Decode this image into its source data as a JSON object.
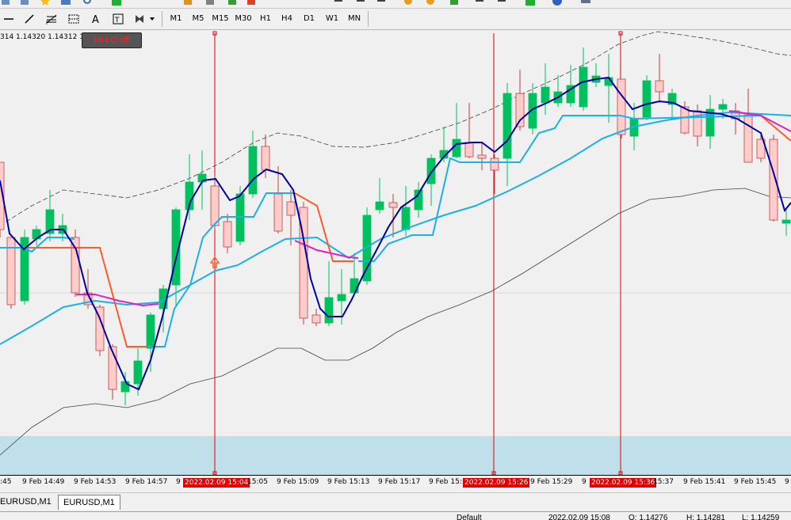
{
  "toolbar": {
    "timeframes": [
      "M1",
      "M5",
      "M15",
      "M30",
      "H1",
      "H4",
      "D1",
      "W1",
      "MN"
    ]
  },
  "chart": {
    "price_strip": "314 1.14320 1.14312 1.14",
    "hilo_button": "Hi-LO off"
  },
  "xaxis": {
    "labels": [
      ":45",
      "9 Feb 14:49",
      "9 Feb 14:53",
      "9 Feb 14:57",
      "9",
      "15:05",
      "9 Feb 15:09",
      "9 Feb 15:13",
      "9 Feb 15:17",
      "9 Feb 15:",
      "9 Feb 15:29",
      "9",
      "15:37",
      "9 Feb 15:41",
      "9 Feb 15:45",
      "9"
    ],
    "markers": [
      "2022.02.09 15:04",
      "2022.02.09 15:26",
      "2022.02.09 15:36"
    ]
  },
  "tabs": [
    "EURUSD,M1",
    "EURUSD,M1"
  ],
  "status": {
    "profile": "Default",
    "datetime": "2022.02.09 15:08",
    "open": "O: 1.14276",
    "high": "H: 1.14281",
    "low": "L: 1.14259"
  },
  "colors": {
    "bull": "#00c060",
    "bear": "#ffcccc",
    "vline": "#e00000",
    "zone": "#bfe0ea",
    "ma_blue": "#1ab0e8",
    "ma_navy": "#0000a0",
    "ma_orange": "#ff5a2a",
    "ma_magenta": "#e020c0"
  },
  "icons": [
    "dash-tool",
    "line-tool",
    "fibonacci-tool",
    "channel-tool",
    "text-tool",
    "label-tool",
    "arrows-tool"
  ]
}
